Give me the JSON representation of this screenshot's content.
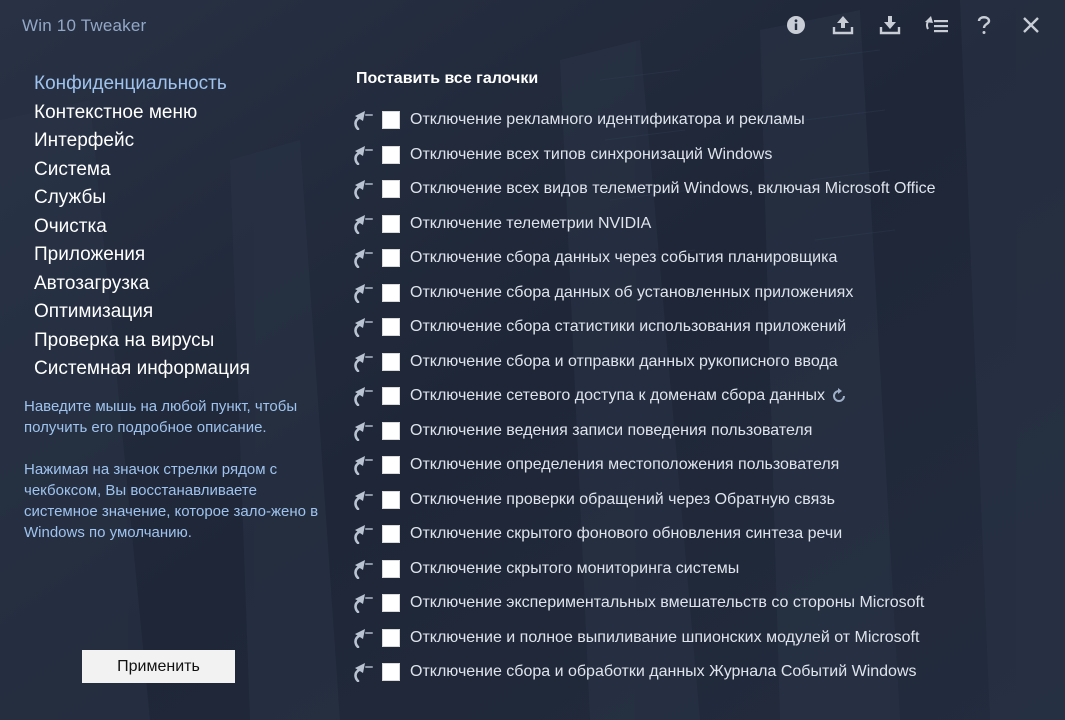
{
  "window": {
    "title": "Win 10 Tweaker"
  },
  "toolbar": {
    "icons": [
      "info-icon",
      "export-icon",
      "import-icon",
      "sort-icon",
      "help-icon",
      "close-icon"
    ]
  },
  "sidebar": {
    "items": [
      {
        "label": "Конфиденциальность",
        "active": true
      },
      {
        "label": "Контекстное меню"
      },
      {
        "label": "Интерфейс"
      },
      {
        "label": "Система"
      },
      {
        "label": "Службы"
      },
      {
        "label": "Очистка"
      },
      {
        "label": "Приложения"
      },
      {
        "label": "Автозагрузка"
      },
      {
        "label": "Оптимизация"
      },
      {
        "label": "Проверка на вирусы"
      },
      {
        "label": "Системная информация"
      }
    ],
    "hint1": "Наведите мышь на любой пункт, чтобы получить его подробное описание.",
    "hint2": "Нажимая на значок стрелки рядом с чекбоксом, Вы восстанавливаете системное значение, которое зало-жено в Windows по умолчанию.",
    "apply_label": "Применить"
  },
  "content": {
    "select_all_label": "Поставить все галочки",
    "options": [
      {
        "label": "Отключение рекламного идентификатора и рекламы",
        "checked": false
      },
      {
        "label": "Отключение всех типов синхронизаций Windows",
        "checked": false
      },
      {
        "label": "Отключение всех видов телеметрий Windows, включая Microsoft Office",
        "checked": false
      },
      {
        "label": "Отключение телеметрии NVIDIA",
        "checked": false
      },
      {
        "label": "Отключение сбора данных через события планировщика",
        "checked": false
      },
      {
        "label": "Отключение сбора данных об установленных приложениях",
        "checked": false
      },
      {
        "label": "Отключение сбора статистики использования приложений",
        "checked": false
      },
      {
        "label": "Отключение сбора и отправки данных рукописного ввода",
        "checked": false
      },
      {
        "label": "Отключение сетевого доступа к доменам сбора данных",
        "checked": false,
        "refresh_icon": true
      },
      {
        "label": "Отключение ведения записи поведения пользователя",
        "checked": false
      },
      {
        "label": "Отключение определения местоположения пользователя",
        "checked": false
      },
      {
        "label": "Отключение проверки обращений через Обратную связь",
        "checked": false
      },
      {
        "label": "Отключение скрытого фонового обновления синтеза речи",
        "checked": false
      },
      {
        "label": "Отключение скрытого мониторинга системы",
        "checked": false
      },
      {
        "label": "Отключение экспериментальных вмешательств со стороны Microsoft",
        "checked": false
      },
      {
        "label": "Отключение и полное выпиливание шпионских модулей от Microsoft",
        "checked": false
      },
      {
        "label": "Отключение сбора и обработки данных Журнала Событий Windows",
        "checked": false
      }
    ]
  },
  "colors": {
    "background": "#1f2838",
    "accent": "#9fc3ee",
    "title": "#93a7c6",
    "icon": "#c9ced6"
  }
}
